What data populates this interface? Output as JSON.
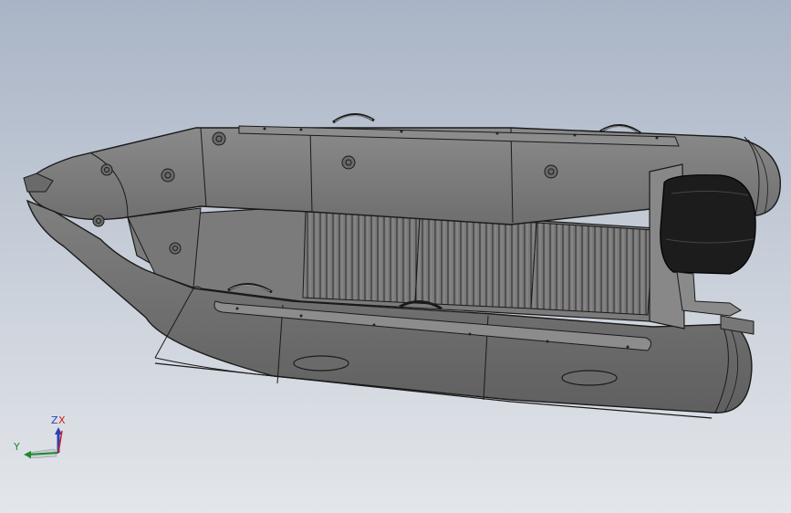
{
  "viewport": {
    "background_top": "#a9b4c6",
    "background_bottom": "#e3e6ea"
  },
  "model": {
    "hull_color": "#7c7c7c",
    "edge_color": "#1a1a1a",
    "floor_color": "#7a7a7a",
    "motor_color": "#1c1c1c"
  },
  "triad": {
    "z_label": "Z",
    "x_label": "X",
    "y_label": "Y",
    "x_color": "#d42020",
    "y_color": "#1d8a2a",
    "z_color": "#2d3fb8"
  }
}
